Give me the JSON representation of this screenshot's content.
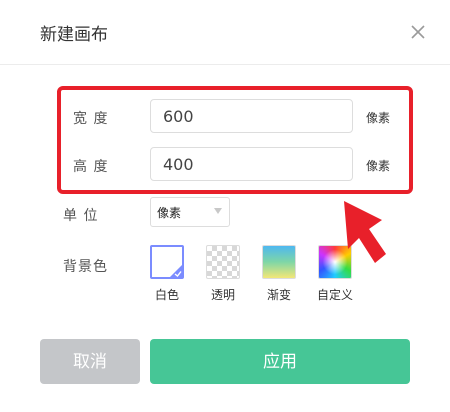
{
  "dialog": {
    "title": "新建画布",
    "close_icon": "close-icon"
  },
  "fields": {
    "width_label": "宽 度",
    "width_value": "600",
    "width_unit": "像素",
    "height_label": "高 度",
    "height_value": "400",
    "height_unit": "像素"
  },
  "unit_row": {
    "label": "单 位",
    "selected": "像素"
  },
  "background": {
    "label": "背景色",
    "options": [
      {
        "label": "白色",
        "selected": true
      },
      {
        "label": "透明",
        "selected": false
      },
      {
        "label": "渐变",
        "selected": false
      },
      {
        "label": "自定义",
        "selected": false
      }
    ]
  },
  "buttons": {
    "cancel": "取消",
    "apply": "应用"
  },
  "colors": {
    "highlight_red": "#e8202a",
    "apply_green": "#46c696",
    "cancel_gray": "#c4c6c9",
    "selected_border": "#7b8cff"
  },
  "annotation": {
    "highlight_box": "red-rectangle",
    "pointer": "red-arrow"
  }
}
